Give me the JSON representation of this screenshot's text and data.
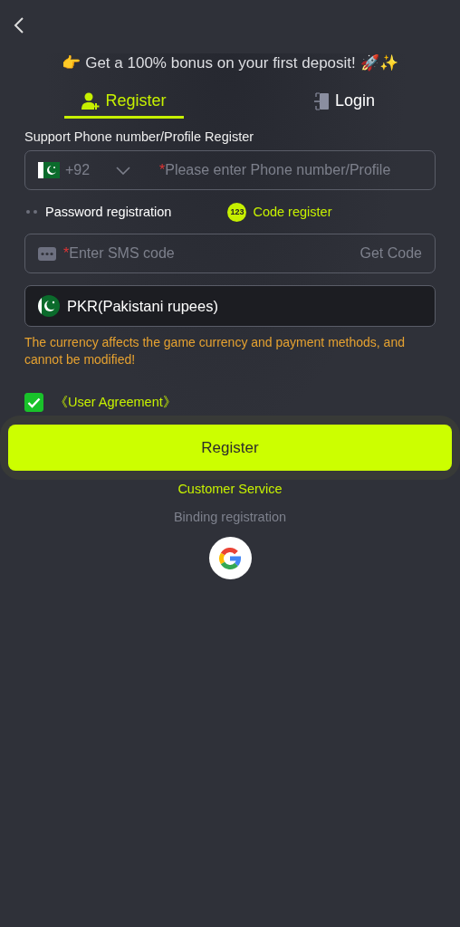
{
  "banner": "👉 Get a 100% bonus on your first deposit! 🚀✨",
  "tabs": [
    {
      "label": "Register",
      "kind": "register",
      "selected": true
    },
    {
      "label": "Login",
      "kind": "login",
      "selected": false
    }
  ],
  "phone_label": "Support Phone number/Profile Register",
  "phone_field": {
    "country_code": "+92",
    "required_mark": "*",
    "placeholder": "Please enter Phone number/Profile"
  },
  "modes": [
    {
      "label": "Password registration",
      "kind": "password",
      "selected": false
    },
    {
      "label": "Code register",
      "kind": "code",
      "badge": "123",
      "selected": true
    }
  ],
  "sms_field": {
    "required_mark": "*",
    "placeholder": "Enter SMS code",
    "action": "Get Code"
  },
  "currency": {
    "value": "PKR(Pakistani rupees)"
  },
  "warning": "The currency affects the game currency and payment methods, and cannot be modified!",
  "agreement": {
    "label": "《User Agreement》",
    "checked": true
  },
  "register_button": "Register",
  "customer_service": "Customer Service",
  "binding_label": "Binding registration",
  "social_logins": [
    {
      "kind": "google"
    }
  ]
}
